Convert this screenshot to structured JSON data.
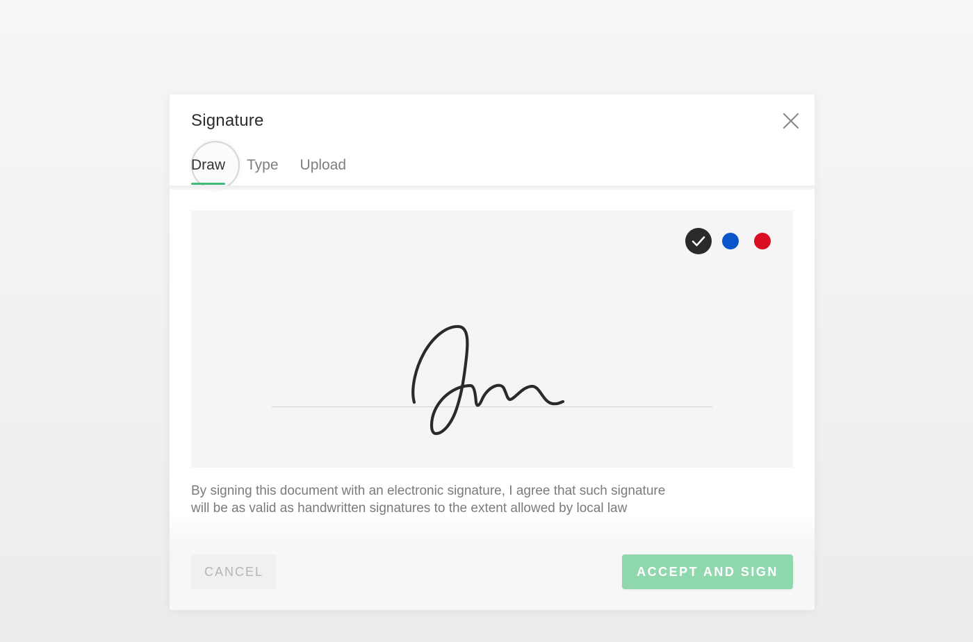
{
  "dialog": {
    "title": "Signature",
    "close_icon": "close-icon"
  },
  "tabs": [
    {
      "label": "Draw",
      "active": true
    },
    {
      "label": "Type",
      "active": false
    },
    {
      "label": "Upload",
      "active": false
    }
  ],
  "draw_panel": {
    "ink_colors": [
      {
        "name": "black",
        "hex": "#2a2a2a",
        "selected": true,
        "icon": "checkmark-icon"
      },
      {
        "name": "blue",
        "hex": "#0a55c9",
        "selected": false
      },
      {
        "name": "red",
        "hex": "#d90e20",
        "selected": false
      }
    ],
    "signature_ink": "#2a2a2a"
  },
  "consent_text": {
    "line1": "By signing this document with an electronic signature, I agree that such signature",
    "line2": "will be as valid as handwritten signatures to the extent allowed by local law"
  },
  "footer": {
    "cancel_label": "CANCEL",
    "accept_label": "ACCEPT AND SIGN"
  },
  "colors": {
    "accent_green": "#3dbb77",
    "accept_button": "#8fd8ae"
  }
}
